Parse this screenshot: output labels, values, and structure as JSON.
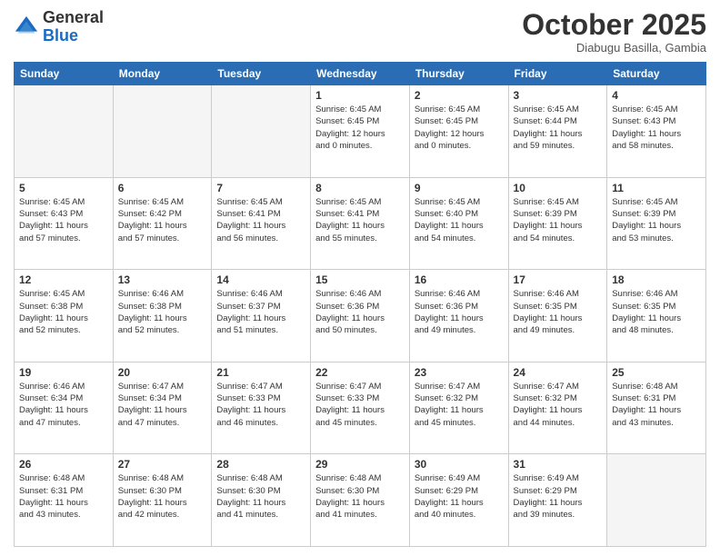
{
  "header": {
    "logo_general": "General",
    "logo_blue": "Blue",
    "month_title": "October 2025",
    "subtitle": "Diabugu Basilla, Gambia"
  },
  "days_of_week": [
    "Sunday",
    "Monday",
    "Tuesday",
    "Wednesday",
    "Thursday",
    "Friday",
    "Saturday"
  ],
  "weeks": [
    [
      {
        "day": "",
        "info": ""
      },
      {
        "day": "",
        "info": ""
      },
      {
        "day": "",
        "info": ""
      },
      {
        "day": "1",
        "info": "Sunrise: 6:45 AM\nSunset: 6:45 PM\nDaylight: 12 hours\nand 0 minutes."
      },
      {
        "day": "2",
        "info": "Sunrise: 6:45 AM\nSunset: 6:45 PM\nDaylight: 12 hours\nand 0 minutes."
      },
      {
        "day": "3",
        "info": "Sunrise: 6:45 AM\nSunset: 6:44 PM\nDaylight: 11 hours\nand 59 minutes."
      },
      {
        "day": "4",
        "info": "Sunrise: 6:45 AM\nSunset: 6:43 PM\nDaylight: 11 hours\nand 58 minutes."
      }
    ],
    [
      {
        "day": "5",
        "info": "Sunrise: 6:45 AM\nSunset: 6:43 PM\nDaylight: 11 hours\nand 57 minutes."
      },
      {
        "day": "6",
        "info": "Sunrise: 6:45 AM\nSunset: 6:42 PM\nDaylight: 11 hours\nand 57 minutes."
      },
      {
        "day": "7",
        "info": "Sunrise: 6:45 AM\nSunset: 6:41 PM\nDaylight: 11 hours\nand 56 minutes."
      },
      {
        "day": "8",
        "info": "Sunrise: 6:45 AM\nSunset: 6:41 PM\nDaylight: 11 hours\nand 55 minutes."
      },
      {
        "day": "9",
        "info": "Sunrise: 6:45 AM\nSunset: 6:40 PM\nDaylight: 11 hours\nand 54 minutes."
      },
      {
        "day": "10",
        "info": "Sunrise: 6:45 AM\nSunset: 6:39 PM\nDaylight: 11 hours\nand 54 minutes."
      },
      {
        "day": "11",
        "info": "Sunrise: 6:45 AM\nSunset: 6:39 PM\nDaylight: 11 hours\nand 53 minutes."
      }
    ],
    [
      {
        "day": "12",
        "info": "Sunrise: 6:45 AM\nSunset: 6:38 PM\nDaylight: 11 hours\nand 52 minutes."
      },
      {
        "day": "13",
        "info": "Sunrise: 6:46 AM\nSunset: 6:38 PM\nDaylight: 11 hours\nand 52 minutes."
      },
      {
        "day": "14",
        "info": "Sunrise: 6:46 AM\nSunset: 6:37 PM\nDaylight: 11 hours\nand 51 minutes."
      },
      {
        "day": "15",
        "info": "Sunrise: 6:46 AM\nSunset: 6:36 PM\nDaylight: 11 hours\nand 50 minutes."
      },
      {
        "day": "16",
        "info": "Sunrise: 6:46 AM\nSunset: 6:36 PM\nDaylight: 11 hours\nand 49 minutes."
      },
      {
        "day": "17",
        "info": "Sunrise: 6:46 AM\nSunset: 6:35 PM\nDaylight: 11 hours\nand 49 minutes."
      },
      {
        "day": "18",
        "info": "Sunrise: 6:46 AM\nSunset: 6:35 PM\nDaylight: 11 hours\nand 48 minutes."
      }
    ],
    [
      {
        "day": "19",
        "info": "Sunrise: 6:46 AM\nSunset: 6:34 PM\nDaylight: 11 hours\nand 47 minutes."
      },
      {
        "day": "20",
        "info": "Sunrise: 6:47 AM\nSunset: 6:34 PM\nDaylight: 11 hours\nand 47 minutes."
      },
      {
        "day": "21",
        "info": "Sunrise: 6:47 AM\nSunset: 6:33 PM\nDaylight: 11 hours\nand 46 minutes."
      },
      {
        "day": "22",
        "info": "Sunrise: 6:47 AM\nSunset: 6:33 PM\nDaylight: 11 hours\nand 45 minutes."
      },
      {
        "day": "23",
        "info": "Sunrise: 6:47 AM\nSunset: 6:32 PM\nDaylight: 11 hours\nand 45 minutes."
      },
      {
        "day": "24",
        "info": "Sunrise: 6:47 AM\nSunset: 6:32 PM\nDaylight: 11 hours\nand 44 minutes."
      },
      {
        "day": "25",
        "info": "Sunrise: 6:48 AM\nSunset: 6:31 PM\nDaylight: 11 hours\nand 43 minutes."
      }
    ],
    [
      {
        "day": "26",
        "info": "Sunrise: 6:48 AM\nSunset: 6:31 PM\nDaylight: 11 hours\nand 43 minutes."
      },
      {
        "day": "27",
        "info": "Sunrise: 6:48 AM\nSunset: 6:30 PM\nDaylight: 11 hours\nand 42 minutes."
      },
      {
        "day": "28",
        "info": "Sunrise: 6:48 AM\nSunset: 6:30 PM\nDaylight: 11 hours\nand 41 minutes."
      },
      {
        "day": "29",
        "info": "Sunrise: 6:48 AM\nSunset: 6:30 PM\nDaylight: 11 hours\nand 41 minutes."
      },
      {
        "day": "30",
        "info": "Sunrise: 6:49 AM\nSunset: 6:29 PM\nDaylight: 11 hours\nand 40 minutes."
      },
      {
        "day": "31",
        "info": "Sunrise: 6:49 AM\nSunset: 6:29 PM\nDaylight: 11 hours\nand 39 minutes."
      },
      {
        "day": "",
        "info": ""
      }
    ]
  ]
}
